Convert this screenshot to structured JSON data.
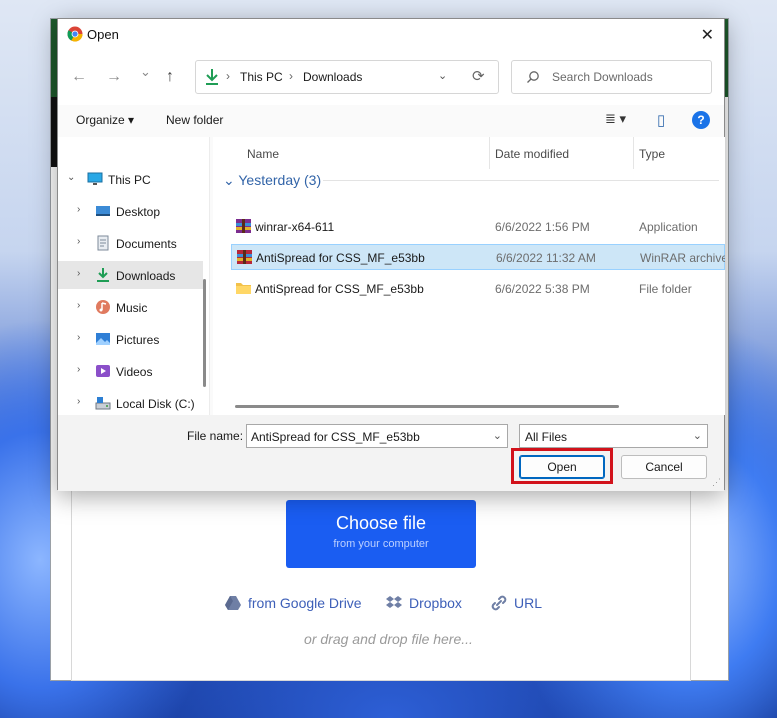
{
  "dialog": {
    "title": "Open",
    "close": "✕"
  },
  "nav": {
    "back": "←",
    "forward": "→",
    "recent": "⌄",
    "up": "↑",
    "breadcrumb": [
      "This PC",
      "Downloads"
    ],
    "breadcrumb_sep": "›",
    "address_dropdown": "⌄",
    "refresh": "⟳",
    "search_placeholder": "Search Downloads"
  },
  "toolbar": {
    "organize": "Organize ▾",
    "new_folder": "New folder",
    "view": "≣ ▾",
    "preview": "▯",
    "help": "?"
  },
  "sidebar": {
    "items": [
      {
        "label": "This PC",
        "expander": "⌄"
      },
      {
        "label": "Desktop",
        "expander": "›"
      },
      {
        "label": "Documents",
        "expander": "›"
      },
      {
        "label": "Downloads",
        "expander": "›"
      },
      {
        "label": "Music",
        "expander": "›"
      },
      {
        "label": "Pictures",
        "expander": "›"
      },
      {
        "label": "Videos",
        "expander": "›"
      },
      {
        "label": "Local Disk (C:)",
        "expander": "›"
      }
    ]
  },
  "files": {
    "columns": {
      "name": "Name",
      "date": "Date modified",
      "type": "Type"
    },
    "group": "⌄  Yesterday (3)",
    "rows": [
      {
        "name": "winrar-x64-611",
        "date": "6/6/2022 1:56 PM",
        "type": "Application",
        "icon": "winrar-icon"
      },
      {
        "name": "AntiSpread for CSS_MF_e53bb",
        "date": "6/6/2022 11:32 AM",
        "type": "WinRAR archive",
        "icon": "archive-icon"
      },
      {
        "name": "AntiSpread for CSS_MF_e53bb",
        "date": "6/6/2022 5:38 PM",
        "type": "File folder",
        "icon": "folder-icon"
      }
    ]
  },
  "bottom": {
    "file_name_label": "File name:",
    "file_name_value": "AntiSpread for CSS_MF_e53bb",
    "file_type_value": "All Files",
    "dropdown": "⌄",
    "open": "Open",
    "cancel": "Cancel"
  },
  "page": {
    "choose_file": "Choose file",
    "choose_sub": "from your computer",
    "google_drive": "from Google Drive",
    "dropbox": "Dropbox",
    "url": "URL",
    "drag_text": "or drag and drop file here..."
  },
  "colors": {
    "accent": "#1a5df2",
    "selection": "#cde6f7",
    "highlight_box": "#d2121b",
    "link": "#3d5fb8"
  }
}
